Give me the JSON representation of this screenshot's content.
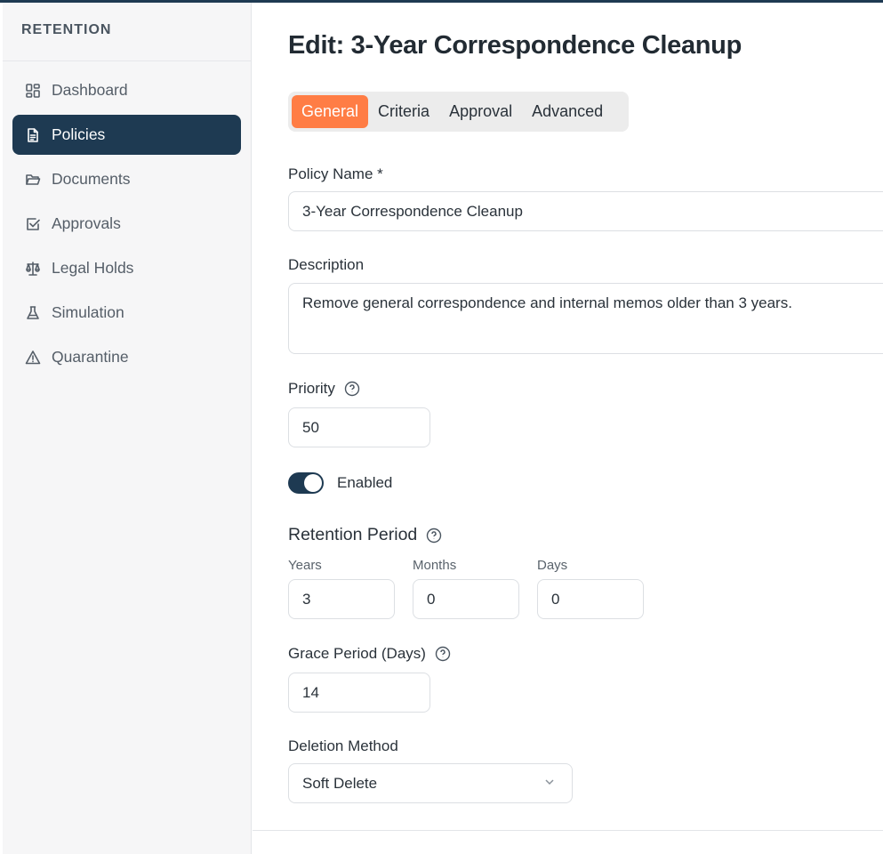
{
  "sidebar": {
    "title": "RETENTION",
    "items": [
      {
        "label": "Dashboard",
        "icon": "dashboard-icon"
      },
      {
        "label": "Policies",
        "icon": "document-icon",
        "active": true
      },
      {
        "label": "Documents",
        "icon": "folder-icon"
      },
      {
        "label": "Approvals",
        "icon": "checkbox-icon"
      },
      {
        "label": "Legal Holds",
        "icon": "scale-icon"
      },
      {
        "label": "Simulation",
        "icon": "flask-icon"
      },
      {
        "label": "Quarantine",
        "icon": "warning-icon"
      }
    ]
  },
  "page": {
    "title": "Edit: 3-Year Correspondence Cleanup"
  },
  "tabs": [
    "General",
    "Criteria",
    "Approval",
    "Advanced"
  ],
  "form": {
    "policy_name": {
      "label": "Policy Name *",
      "value": "3-Year Correspondence Cleanup"
    },
    "description": {
      "label": "Description",
      "value": "Remove general correspondence and internal memos older than 3 years."
    },
    "priority": {
      "label": "Priority",
      "value": "50"
    },
    "enabled": {
      "label": "Enabled",
      "on": true
    },
    "retention": {
      "label": "Retention Period",
      "years_label": "Years",
      "years": "3",
      "months_label": "Months",
      "months": "0",
      "days_label": "Days",
      "days": "0"
    },
    "grace": {
      "label": "Grace Period (Days)",
      "value": "14"
    },
    "deletion": {
      "label": "Deletion Method",
      "value": "Soft Delete"
    }
  },
  "colors": {
    "primary": "#1e3a52",
    "accent": "#ff7d45"
  }
}
